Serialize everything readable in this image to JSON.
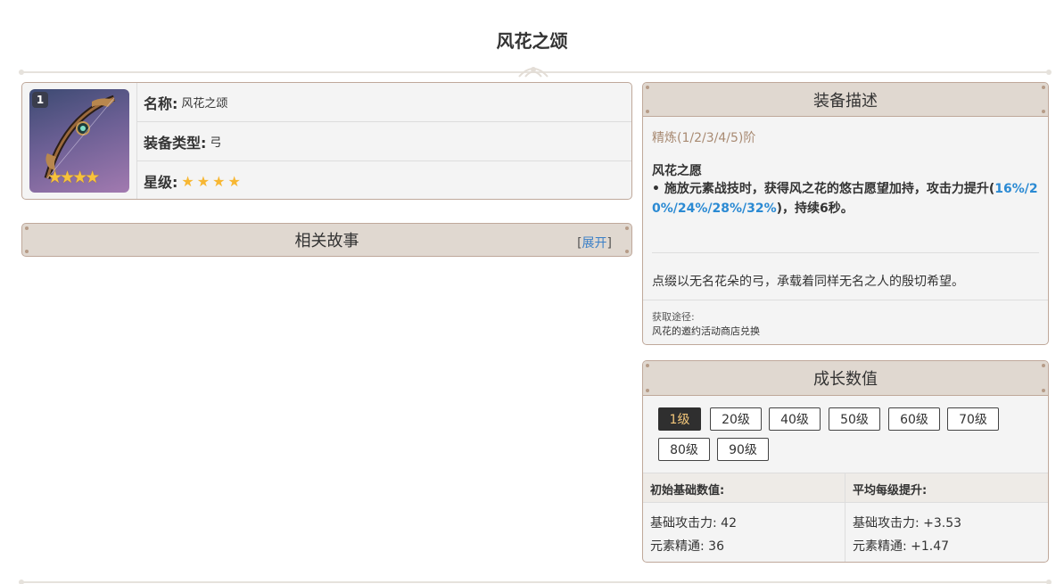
{
  "page": {
    "title": "风花之颂"
  },
  "weapon": {
    "refine_badge": "1",
    "image_stars": "★★★★",
    "name_label": "名称:",
    "name_value": "风花之颂",
    "type_label": "装备类型:",
    "type_value": "弓",
    "rarity_label": "星级:",
    "rarity_stars": "★★★★",
    "rarity_count": 4
  },
  "story": {
    "header": "相关故事",
    "expand_open": "[",
    "expand_label": "展开",
    "expand_close": "]"
  },
  "description": {
    "header": "装备描述",
    "refine_line": "精炼(1/2/3/4/5)阶",
    "skill_name": "风花之愿",
    "skill_text_before": "• 施放元素战技时，获得风之花的悠古愿望加持，攻击力提升(",
    "skill_values": "16%/20%/24%/28%/32%",
    "skill_text_after": ")，持续6秒。",
    "flavor": "点缀以无名花朵的弓，承载着同样无名之人的殷切希望。",
    "source_label": "获取途径:",
    "source_value": "风花的邀约活动商店兑换"
  },
  "growth": {
    "header": "成长数值",
    "levels": [
      "1级",
      "20级",
      "40级",
      "50级",
      "60级",
      "70级",
      "80级",
      "90级"
    ],
    "selected_level": "1级",
    "base_header": "初始基础数值:",
    "avg_header": "平均每级提升:",
    "base_stats": [
      {
        "label": "基础攻击力:",
        "value": "42"
      },
      {
        "label": "元素精通:",
        "value": "36"
      }
    ],
    "avg_stats": [
      {
        "label": "基础攻击力:",
        "value": "+3.53"
      },
      {
        "label": "元素精通:",
        "value": "+1.47"
      }
    ]
  },
  "colors": {
    "accent_gold": "#f7b733",
    "header_bg": "#e0d8d0",
    "border": "#bfa89a",
    "highlight_blue": "#2b8ad3",
    "refine_brown": "#a88a72"
  }
}
